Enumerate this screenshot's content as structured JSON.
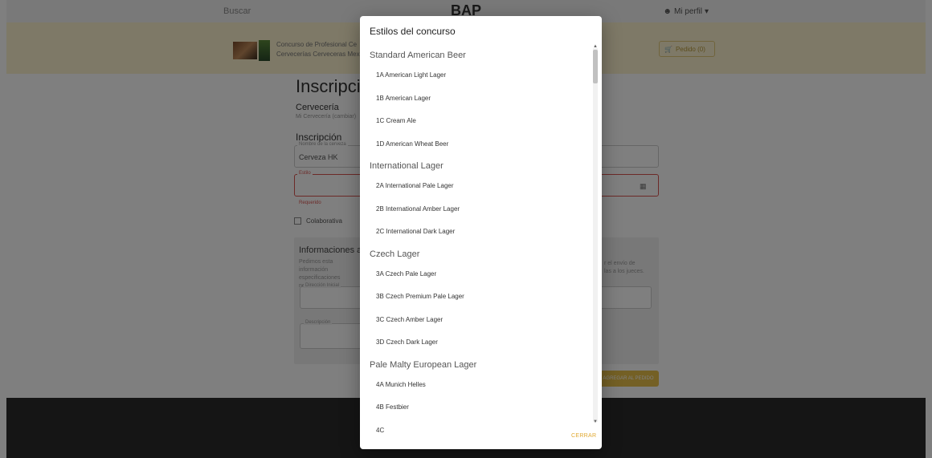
{
  "topbar": {
    "left_link": "Buscar",
    "brand": "BAP",
    "user": "Mi perfil"
  },
  "header": {
    "contest_name_line1": "Concurso de Profesional Ce",
    "contest_name_line2": "Cervecerías Cerveceras Mex",
    "cart_label": "Pedido (0)"
  },
  "form": {
    "title": "Inscripción",
    "brewery_label": "Cervecería",
    "brewery_sub": "Mi Cervecería (cambiar)",
    "inscription_label": "Inscripción",
    "name_field_label": "Nombre de la cerveza",
    "name_field_value": "Cerveza HK",
    "style_field_label": "Estilo",
    "error_text": "Requerido",
    "collab_label": "Colaborativa",
    "info_title": "Informaciones a",
    "info_desc": "Pedimos esta información",
    "info_desc2": "especificaciones necesaria",
    "info_desc_right1": "r el envío de",
    "info_desc_right2": "las a los jueces.",
    "field3_label": "Dirección Inicial",
    "field4_label": "Descripción",
    "add_button": "AGREGAR AL PEDIDO"
  },
  "modal": {
    "title": "Estilos del concurso",
    "close_button": "CERRAR",
    "categories": [
      {
        "name": "Standard American Beer",
        "items": [
          "1A American Light Lager",
          "1B American Lager",
          "1C Cream Ale",
          "1D American Wheat Beer"
        ]
      },
      {
        "name": "International Lager",
        "items": [
          "2A International Pale Lager",
          "2B International Amber Lager",
          "2C International Dark Lager"
        ]
      },
      {
        "name": "Czech Lager",
        "items": [
          "3A Czech Pale Lager",
          "3B Czech Premium Pale Lager",
          "3C Czech Amber Lager",
          "3D Czech Dark Lager"
        ]
      },
      {
        "name": "Pale Malty European Lager",
        "items": [
          "4A Munich Helles",
          "4B Festbier",
          "4C"
        ]
      }
    ]
  },
  "colors": {
    "accent": "#e8c04a",
    "header_bg": "#fdf3cf",
    "error": "#d9534f"
  }
}
